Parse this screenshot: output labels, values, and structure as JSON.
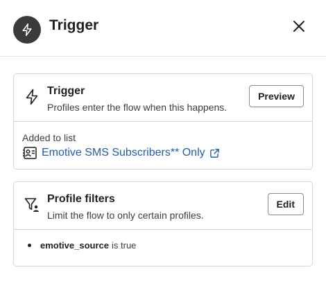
{
  "header": {
    "title": "Trigger",
    "icon": "lightning-icon",
    "close_icon": "close-icon"
  },
  "trigger_card": {
    "title": "Trigger",
    "subtitle": "Profiles enter the flow when this happens.",
    "button_label": "Preview",
    "added_label": "Added to list",
    "list_name": "Emotive SMS Subscribers** Only",
    "list_icon": "contact-list-icon",
    "external_icon": "external-link-icon"
  },
  "filters_card": {
    "title": "Profile filters",
    "subtitle": "Limit the flow to only certain profiles.",
    "button_label": "Edit",
    "icon": "filter-person-icon",
    "filter": {
      "key": "emotive_source",
      "condition": "is true"
    }
  },
  "colors": {
    "link": "#1c5db0",
    "avatar_bg": "#3b3b3b",
    "border": "#d6d6d6"
  }
}
